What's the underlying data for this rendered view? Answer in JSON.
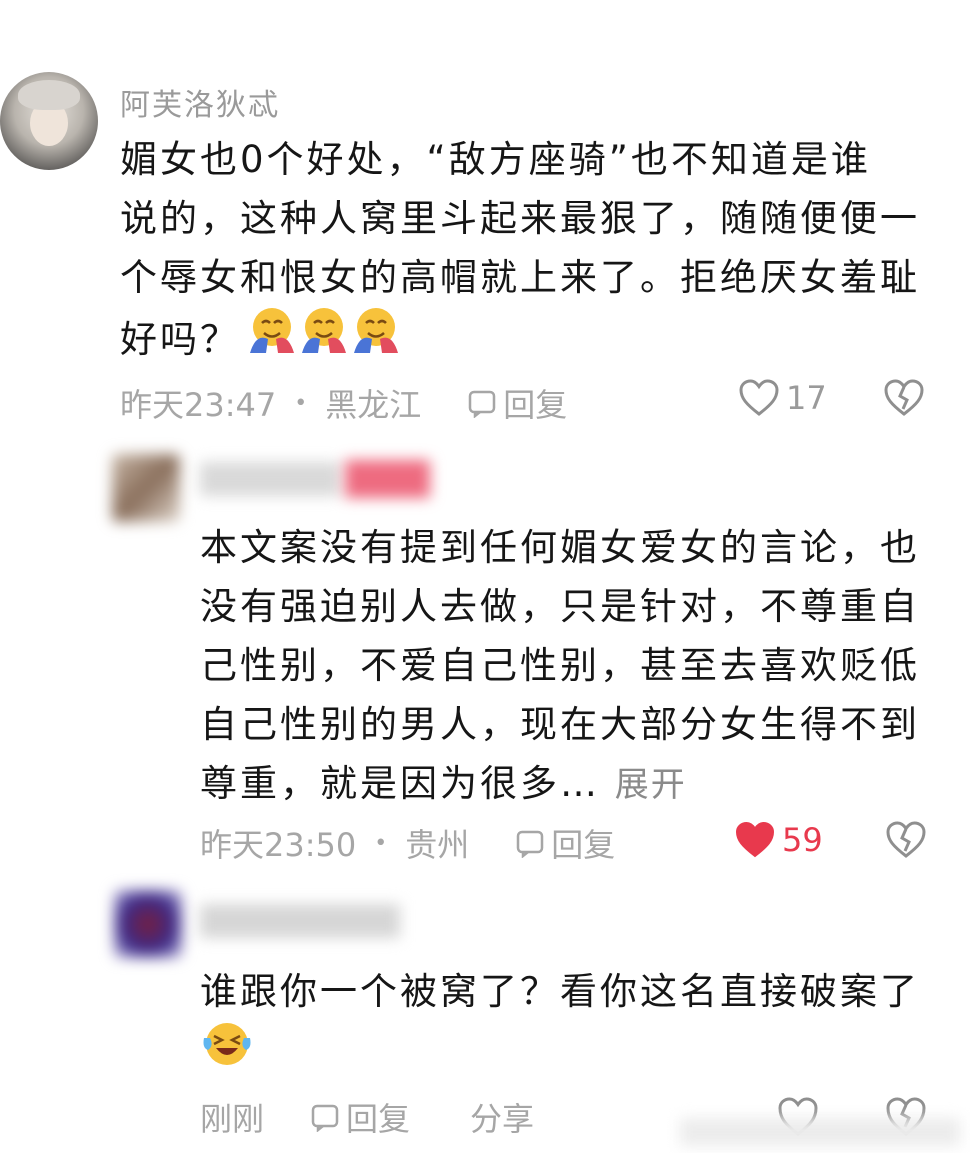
{
  "comments": [
    {
      "username": "阿芙洛狄忒",
      "lines": [
        "媚女也0个好处，“敌方座骑”也不知道是谁",
        "说的，这种人窝里斗起来最狠了，随随便便一",
        "个辱女和恨女的高帽就上来了。拒绝厌女羞耻",
        "好吗？"
      ],
      "emoji": "hugging-face-icon",
      "time": "昨天23:47",
      "location": "黑龙江",
      "reply_label": "回复",
      "likes": "17"
    },
    {
      "username": "",
      "lines": [
        "本文案没有提到任何媚女爱女的言论，也",
        "没有强迫别人去做，只是针对，不尊重自",
        "己性别，不爱自己性别，甚至去喜欢贬低",
        "自己性别的男人，现在大部分女生得不到"
      ],
      "last_line": "尊重，就是因为很多…",
      "expand_label": "展开",
      "time": "昨天23:50",
      "location": "贵州",
      "reply_label": "回复",
      "likes": "59",
      "liked": true,
      "like_color": "#e8394d"
    },
    {
      "username": "",
      "lines": [
        "谁跟你一个被窝了？看你这名直接破案了"
      ],
      "emoji": "crying-laughing-face-icon",
      "time": "刚刚",
      "reply_label": "回复",
      "share_label": "分享"
    }
  ]
}
